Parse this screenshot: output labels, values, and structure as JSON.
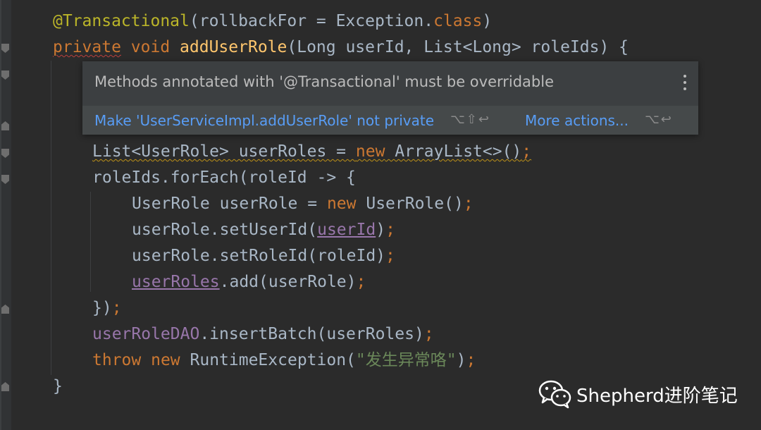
{
  "editor": {
    "lines": [
      {
        "tokens": [
          {
            "t": "@Transactional",
            "c": "ann"
          },
          {
            "t": "(rollbackFor = Exception.",
            "c": "pt"
          },
          {
            "t": "class",
            "c": "kw"
          },
          {
            "t": ")",
            "c": "pt"
          }
        ]
      },
      {
        "tokens": [
          {
            "t": "private",
            "c": "kw wavy"
          },
          {
            "t": " ",
            "c": "pt"
          },
          {
            "t": "void",
            "c": "kw"
          },
          {
            "t": " ",
            "c": "pt"
          },
          {
            "t": "addUserRole",
            "c": "fn"
          },
          {
            "t": "(Long userId, List<Long> roleIds) {",
            "c": "pt"
          }
        ]
      },
      {
        "tokens": []
      },
      {
        "tokens": []
      },
      {
        "tokens": []
      },
      {
        "tokens": [
          {
            "t": "List<UserRole> userRoles = ",
            "c": "pt wavy-warn"
          },
          {
            "t": "new",
            "c": "kw wavy-warn"
          },
          {
            "t": " ArrayList<>()",
            "c": "pt wavy-warn"
          },
          {
            "t": ";",
            "c": "semi wavy-warn"
          }
        ]
      },
      {
        "tokens": [
          {
            "t": "roleIds.forEach(roleId -> {",
            "c": "pt"
          }
        ]
      },
      {
        "tokens": [
          {
            "t": "UserRole userRole = ",
            "c": "pt"
          },
          {
            "t": "new",
            "c": "kw"
          },
          {
            "t": " UserRole()",
            "c": "pt"
          },
          {
            "t": ";",
            "c": "semi"
          }
        ]
      },
      {
        "tokens": [
          {
            "t": "userRole.setUserId(",
            "c": "pt"
          },
          {
            "t": "userId",
            "c": "var under"
          },
          {
            "t": ")",
            "c": "pt"
          },
          {
            "t": ";",
            "c": "semi"
          }
        ]
      },
      {
        "tokens": [
          {
            "t": "userRole.setRoleId(roleId)",
            "c": "pt"
          },
          {
            "t": ";",
            "c": "semi"
          }
        ]
      },
      {
        "tokens": [
          {
            "t": "userRoles",
            "c": "var under"
          },
          {
            "t": ".add(userRole)",
            "c": "pt"
          },
          {
            "t": ";",
            "c": "semi"
          }
        ]
      },
      {
        "tokens": [
          {
            "t": "})",
            "c": "pt"
          },
          {
            "t": ";",
            "c": "semi"
          }
        ]
      },
      {
        "tokens": [
          {
            "t": "userRoleDAO",
            "c": "var"
          },
          {
            "t": ".insertBatch(userRoles)",
            "c": "pt"
          },
          {
            "t": ";",
            "c": "semi"
          }
        ]
      },
      {
        "tokens": [
          {
            "t": "throw",
            "c": "kw"
          },
          {
            "t": " ",
            "c": "pt"
          },
          {
            "t": "new",
            "c": "kw"
          },
          {
            "t": " RuntimeException(",
            "c": "pt"
          },
          {
            "t": "\"发生异常咯\"",
            "c": "str"
          },
          {
            "t": ")",
            "c": "pt"
          },
          {
            "t": ";",
            "c": "semi"
          }
        ]
      },
      {
        "tokens": [
          {
            "t": "}",
            "c": "pt"
          }
        ]
      }
    ]
  },
  "popup": {
    "message": "Methods annotated with '@Transactional' must be overridable",
    "primary_action": "Make 'UserServiceImpl.addUserRole' not private",
    "primary_shortcut": "⌥⇧↩",
    "more_actions": "More actions...",
    "more_shortcut": "⌥↩"
  },
  "watermark": {
    "text": "Shepherd进阶笔记",
    "icon": "wechat-icon"
  },
  "colors": {
    "background": "#2b2b2b",
    "keyword": "#cc7832",
    "annotation": "#bbb529",
    "method": "#ffc66d",
    "field": "#9876aa",
    "string": "#6a8759",
    "text": "#a9b7c6",
    "link": "#589df6"
  }
}
